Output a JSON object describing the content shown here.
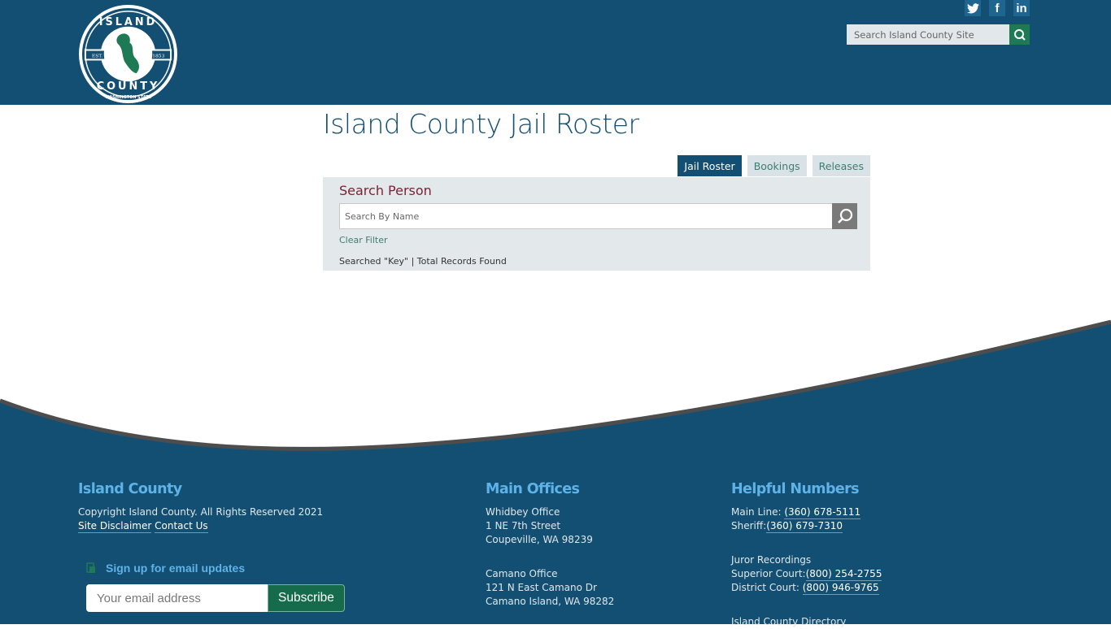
{
  "header": {
    "logo": {
      "top_text": "ISLAND",
      "bottom_text": "COUNTY",
      "est_label": "EST.",
      "est_year": "1853",
      "state_text": "WASHINGTON STATE"
    },
    "social": [
      {
        "name": "twitter-icon",
        "glyph": "✦"
      },
      {
        "name": "facebook-icon",
        "glyph": "f"
      },
      {
        "name": "linkedin-icon",
        "glyph": "in"
      }
    ],
    "site_search": {
      "placeholder": "Search Island County Site",
      "value": ""
    }
  },
  "main": {
    "title": "Island County Jail Roster",
    "tabs": [
      {
        "label": "Jail Roster",
        "active": true
      },
      {
        "label": "Bookings",
        "active": false
      },
      {
        "label": "Releases",
        "active": false
      }
    ],
    "search_panel": {
      "title": "Search Person",
      "placeholder": "Search By Name",
      "value": "",
      "clear_filter": "Clear Filter",
      "summary": "Searched \"Key\" | Total Records Found"
    }
  },
  "footer": {
    "about": {
      "heading": "Island County",
      "copyright": "Copyright Island County. All Rights Reserved 2021",
      "links": [
        "Site Disclaimer",
        "Contact Us"
      ]
    },
    "signup": {
      "label": "Sign up for email updates",
      "placeholder": "Your email address",
      "value": "",
      "button": "Subscribe"
    },
    "offices": {
      "heading": "Main Offices",
      "whidbey": [
        "Whidbey Office",
        "1 NE 7th Street",
        "Coupeville, WA 98239"
      ],
      "camano": [
        "Camano Office",
        "121 N East Camano Dr",
        "Camano Island, WA 98282"
      ]
    },
    "numbers": {
      "heading": "Helpful Numbers",
      "main_label": "Main Line: ",
      "main_phone": "(360) 678-5111",
      "sheriff_label": "Sheriff:",
      "sheriff_phone": "(360) 679-7310",
      "juror_heading": "Juror Recordings",
      "superior_label": "Superior Court:",
      "superior_phone": "(800) 254-2755",
      "district_label": "District Court: ",
      "district_phone": "(800) 946-9765",
      "directory": "Island County Directory"
    }
  },
  "colors": {
    "brand": "#134f72",
    "accent_green": "#1e7a55",
    "heading_blue": "#5db2e8",
    "panel_title": "#7d2233"
  }
}
